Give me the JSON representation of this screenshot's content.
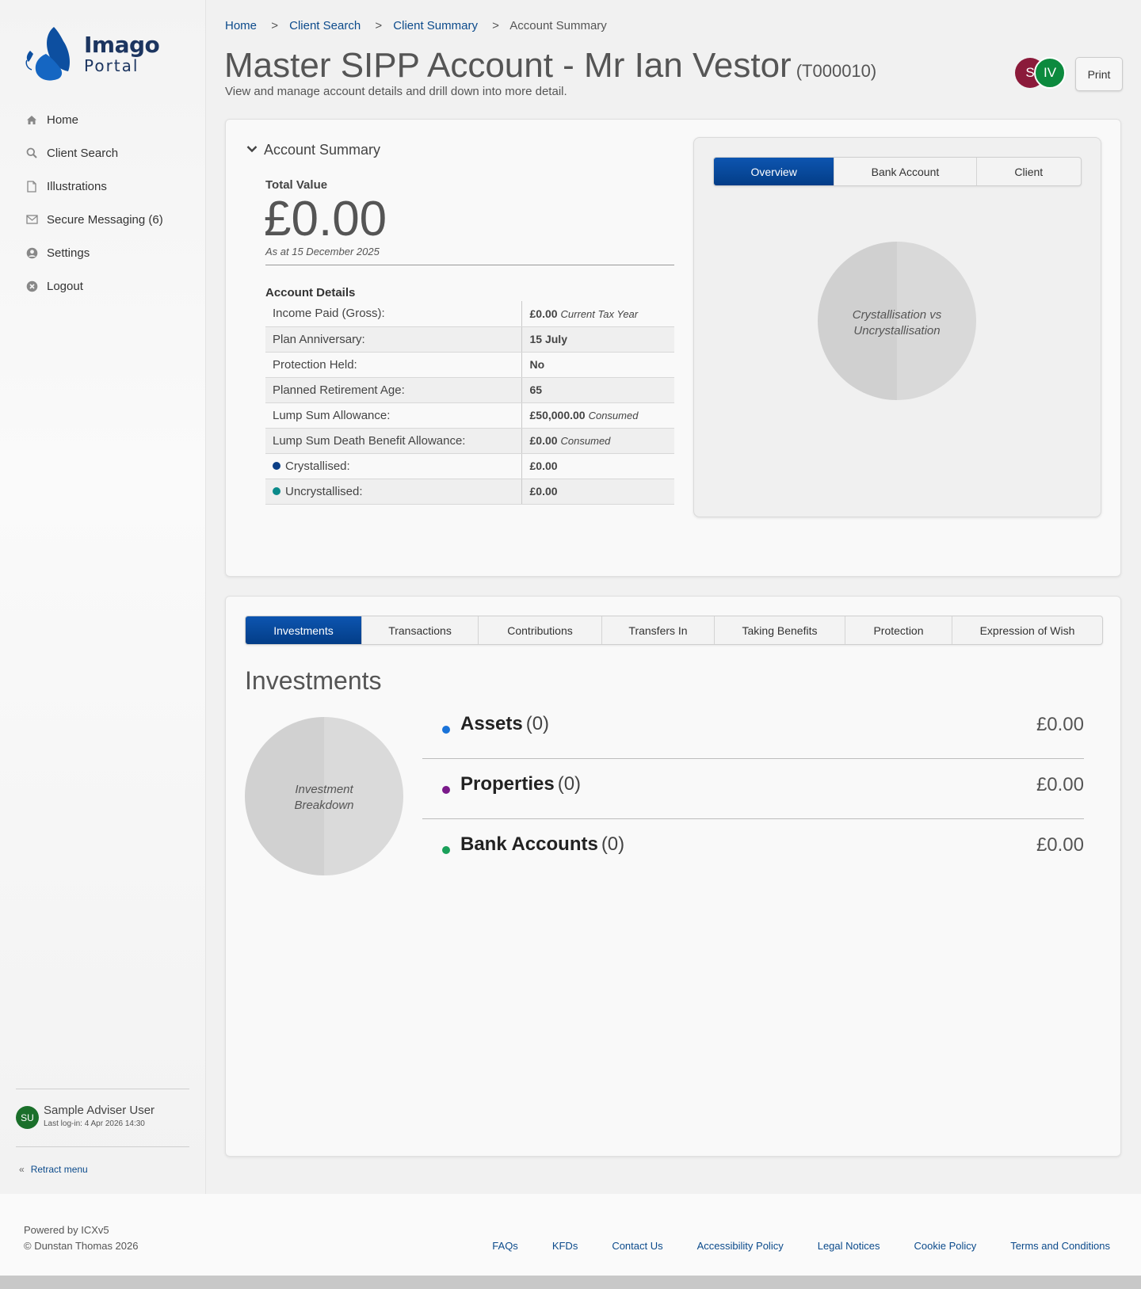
{
  "logo": {
    "word1": "Imago",
    "word2": "Portal"
  },
  "sidebar": {
    "items": [
      {
        "label": "Home",
        "icon": "home-icon"
      },
      {
        "label": "Client Search",
        "icon": "search-icon"
      },
      {
        "label": "Illustrations",
        "icon": "document-icon"
      },
      {
        "label": "Secure Messaging (6)",
        "icon": "envelope-icon"
      },
      {
        "label": "Settings",
        "icon": "user-circle-icon"
      },
      {
        "label": "Logout",
        "icon": "close-circle-icon"
      }
    ],
    "user": {
      "initials": "SU",
      "name": "Sample Adviser User",
      "last_login": "Last log-in: 4 Apr 2026 14:30"
    },
    "retract_label": "Retract menu"
  },
  "breadcrumb": {
    "items": [
      "Home",
      "Client Search",
      "Client Summary"
    ],
    "separator": ">",
    "current": "Account Summary"
  },
  "header": {
    "title": "Master SIPP Account - Mr Ian Vestor",
    "ref": "(T000010)",
    "subtitle": "View and manage account details and drill down into more detail.",
    "avatar_1": "S",
    "avatar_2": "IV",
    "print_label": "Print"
  },
  "summary": {
    "section_label": "Account Summary",
    "total_label": "Total Value",
    "total_value": "£0.00",
    "as_at": "As at 15 December 2025",
    "details_label": "Account Details",
    "rows": [
      {
        "key": "Income Paid (Gross):",
        "value": "£0.00",
        "note": "Current Tax Year"
      },
      {
        "key": "Plan Anniversary:",
        "value": "15 July",
        "note": ""
      },
      {
        "key": "Protection Held:",
        "value": "No",
        "note": ""
      },
      {
        "key": "Planned Retirement Age:",
        "value": "65",
        "note": ""
      },
      {
        "key": "Lump Sum Allowance:",
        "value": "£50,000.00",
        "note": "Consumed"
      },
      {
        "key": "Lump Sum Death Benefit Allowance:",
        "value": "£0.00",
        "note": "Consumed"
      },
      {
        "key": "Crystallised:",
        "value": "£0.00",
        "note": ""
      },
      {
        "key": "Uncrystallised:",
        "value": "£0.00",
        "note": ""
      }
    ],
    "crystallised_color": "#0b3f86",
    "uncrystallised_color": "#0a8a8a",
    "tabs": [
      "Overview",
      "Bank Account",
      "Client"
    ],
    "pie_label_line1": "Crystallisation vs",
    "pie_label_line2": "Uncrystallisation"
  },
  "investments": {
    "tabs": [
      "Investments",
      "Transactions",
      "Contributions",
      "Transfers In",
      "Taking Benefits",
      "Protection",
      "Expression of Wish"
    ],
    "title": "Investments",
    "pie_label_line1": "Investment",
    "pie_label_line2": "Breakdown",
    "rows": [
      {
        "name": "Assets",
        "count": "(0)",
        "amount": "£0.00",
        "color": "#1a73d9"
      },
      {
        "name": "Properties",
        "count": "(0)",
        "amount": "£0.00",
        "color": "#7a1a8a"
      },
      {
        "name": "Bank Accounts",
        "count": "(0)",
        "amount": "£0.00",
        "color": "#1aa05a"
      }
    ]
  },
  "footer": {
    "powered": "Powered by ICXv5",
    "copyright": "© Dunstan Thomas 2026",
    "links": [
      "FAQs",
      "KFDs",
      "Contact Us",
      "Accessibility Policy",
      "Legal Notices",
      "Cookie Policy",
      "Terms and Conditions"
    ]
  },
  "colors": {
    "accent": "#0b4a8b",
    "tab_active": "#034a9c"
  }
}
